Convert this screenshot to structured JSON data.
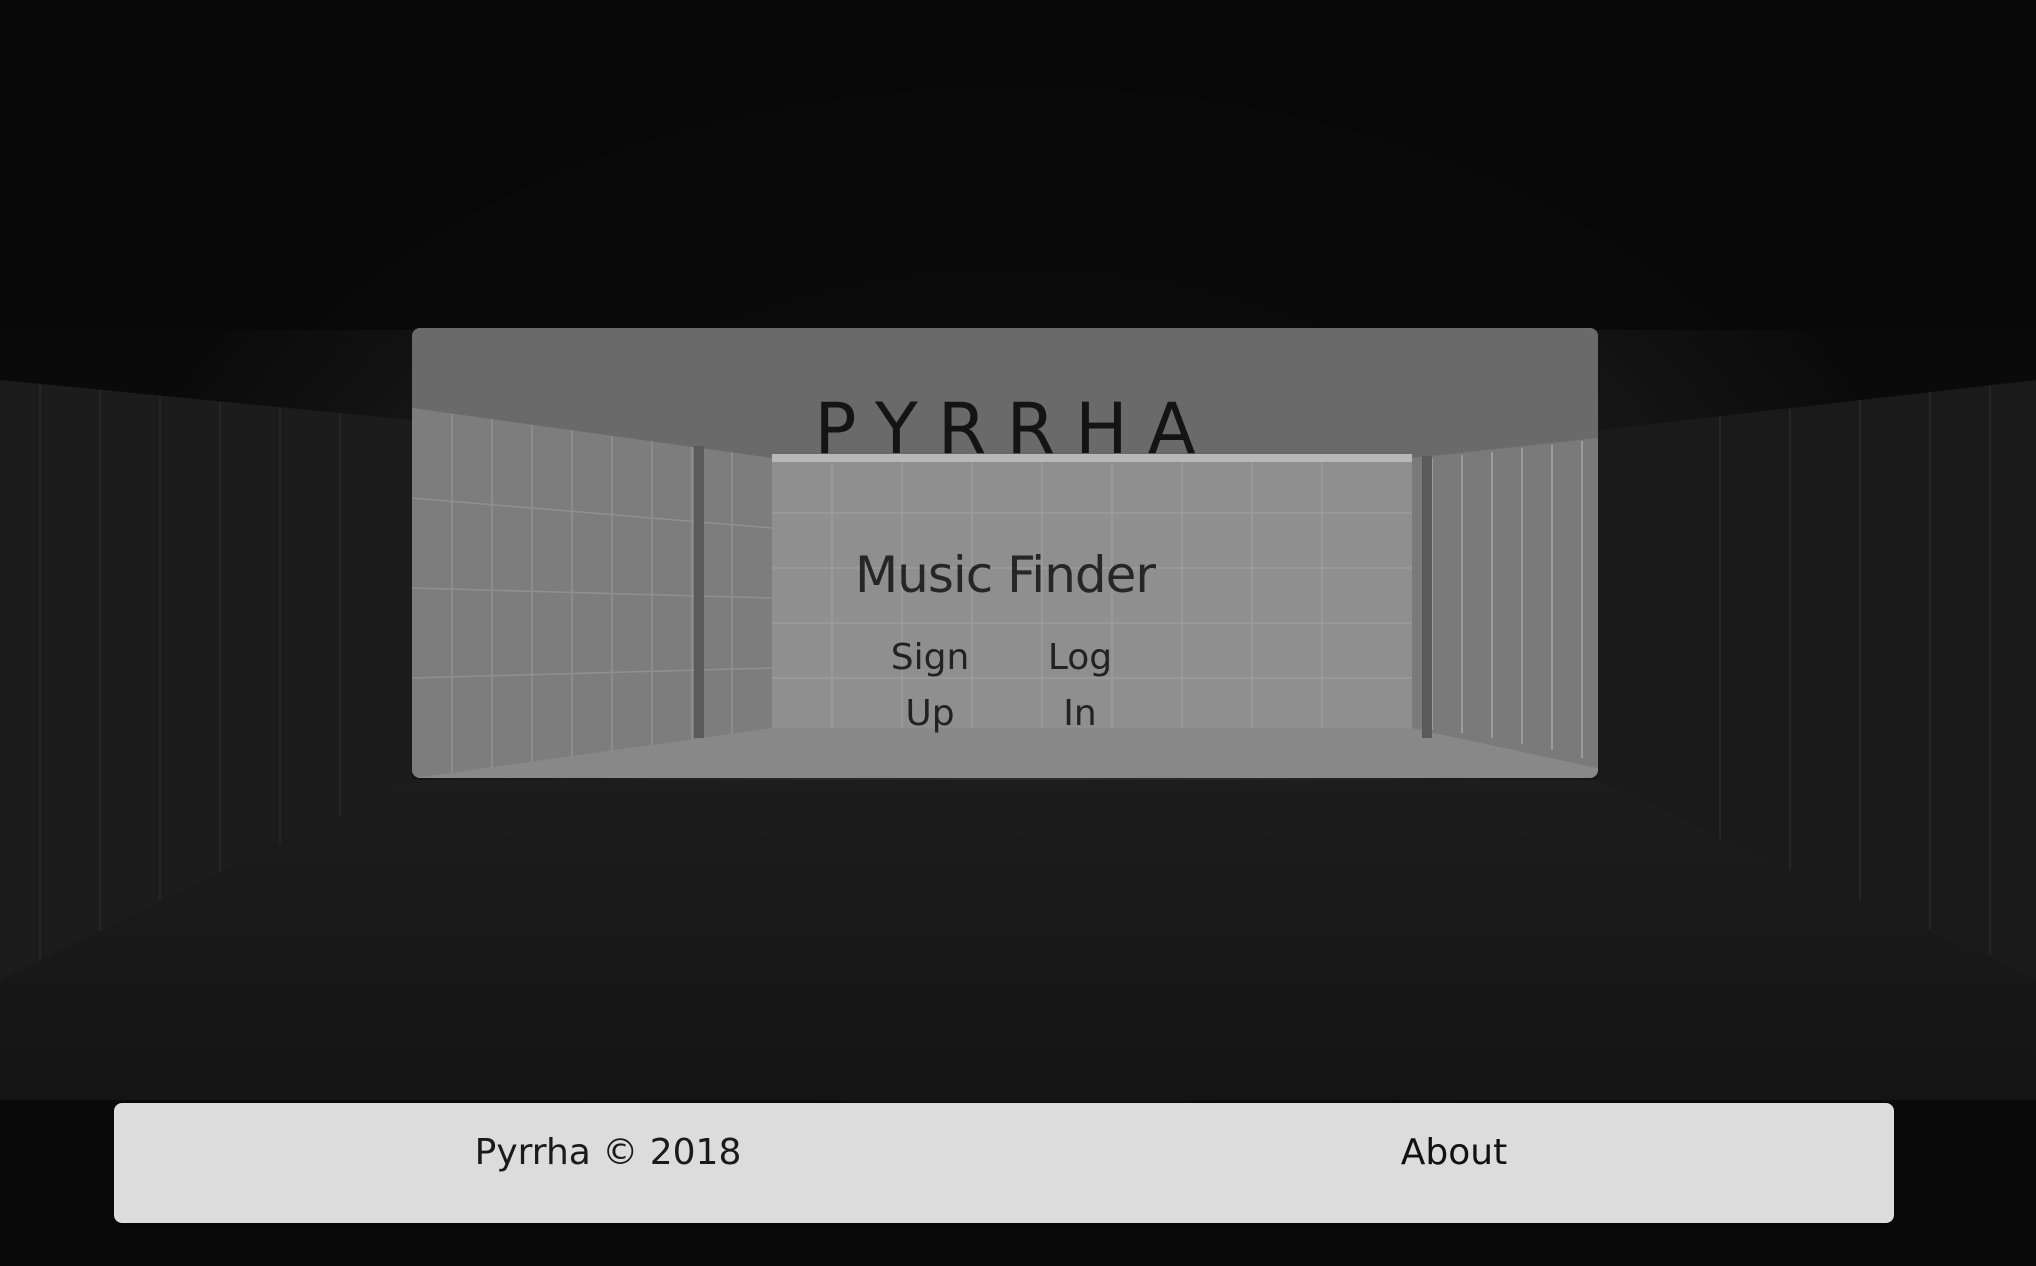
{
  "hero": {
    "brand": "PYRRHA",
    "subtitle": "Music Finder",
    "signup_label": "Sign Up",
    "login_label": "Log In"
  },
  "footer": {
    "copyright": "Pyrrha © 2018",
    "about_label": "About"
  },
  "colors": {
    "page_background": "#0b0b0b",
    "hero_overlay": "#969696",
    "footer_background": "#dcdcdc",
    "text_dark": "#141414"
  }
}
